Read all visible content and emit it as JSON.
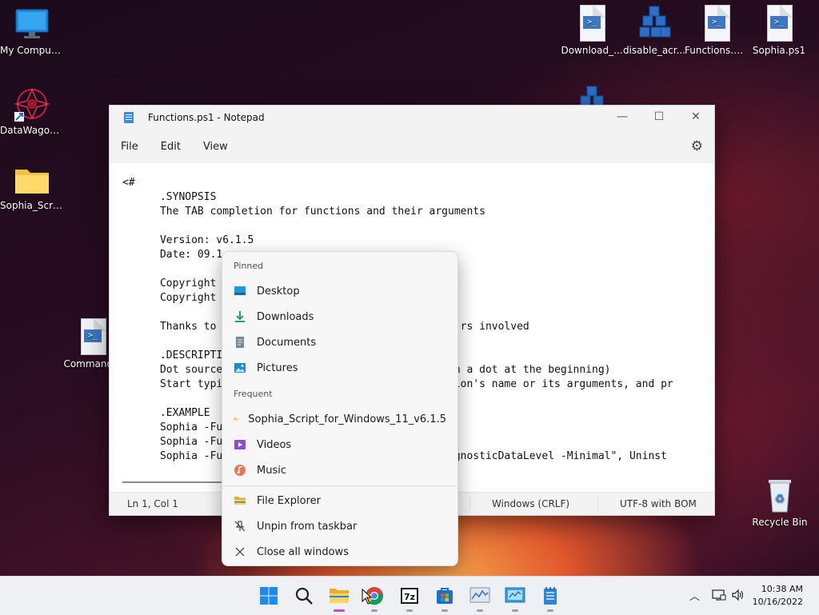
{
  "desktop": {
    "icons": [
      {
        "label": "My Computer"
      },
      {
        "label": "DataWagon..."
      },
      {
        "label": "Sophia_Scri..."
      },
      {
        "label": "Command..."
      },
      {
        "label": "Download_..."
      },
      {
        "label": "disable_acr..."
      },
      {
        "label": "Functions.ps1"
      },
      {
        "label": "Sophia.ps1"
      },
      {
        "label": "Recycle Bin"
      }
    ]
  },
  "notepad": {
    "title": "Functions.ps1 - Notepad",
    "menu": [
      "File",
      "Edit",
      "View"
    ],
    "controls": {
      "minimize": "—",
      "maximize": "☐",
      "close": "✕"
    },
    "settings_icon": "gear-icon",
    "content": "<#\n      .SYNOPSIS\n      The TAB completion for functions and their arguments\n\n      Version: v6.1.5\n      Date: 09.1\n\n      Copyright\n      Copyright\n\n      Thanks to                                       rs involved\n\n      .DESCRIPTI\n      Dot source                                 (with a dot at the beginning)\n      Start typi                                 unction's name or its arguments, and pr\n\n      .EXAMPLE\n      Sophia -Fu\n      Sophia -Fu\n      Sophia -Fu                                 \"DiagnosticDataLevel -Minimal\", Uninst",
    "status": {
      "position": "Ln 1, Col 1",
      "line_ending": "Windows (CRLF)",
      "encoding": "UTF-8 with BOM"
    }
  },
  "jumplist": {
    "pinned_header": "Pinned",
    "pinned": [
      {
        "label": "Desktop",
        "icon": "desktop-folder-icon"
      },
      {
        "label": "Downloads",
        "icon": "download-icon"
      },
      {
        "label": "Documents",
        "icon": "documents-icon"
      },
      {
        "label": "Pictures",
        "icon": "pictures-icon"
      }
    ],
    "frequent_header": "Frequent",
    "frequent": [
      {
        "label": "Sophia_Script_for_Windows_11_v6.1.5",
        "icon": "folder-icon"
      },
      {
        "label": "Videos",
        "icon": "videos-icon"
      },
      {
        "label": "Music",
        "icon": "music-icon"
      }
    ],
    "tasks": [
      {
        "label": "File Explorer",
        "icon": "file-explorer-icon"
      },
      {
        "label": "Unpin from taskbar",
        "icon": "unpin-icon"
      },
      {
        "label": "Close all windows",
        "icon": "close-icon"
      }
    ]
  },
  "taskbar": {
    "time": "10:38 AM",
    "date": "10/16/2022"
  },
  "colors": {
    "accent": "#0067c0",
    "active_indicator": "#c44fc1"
  }
}
